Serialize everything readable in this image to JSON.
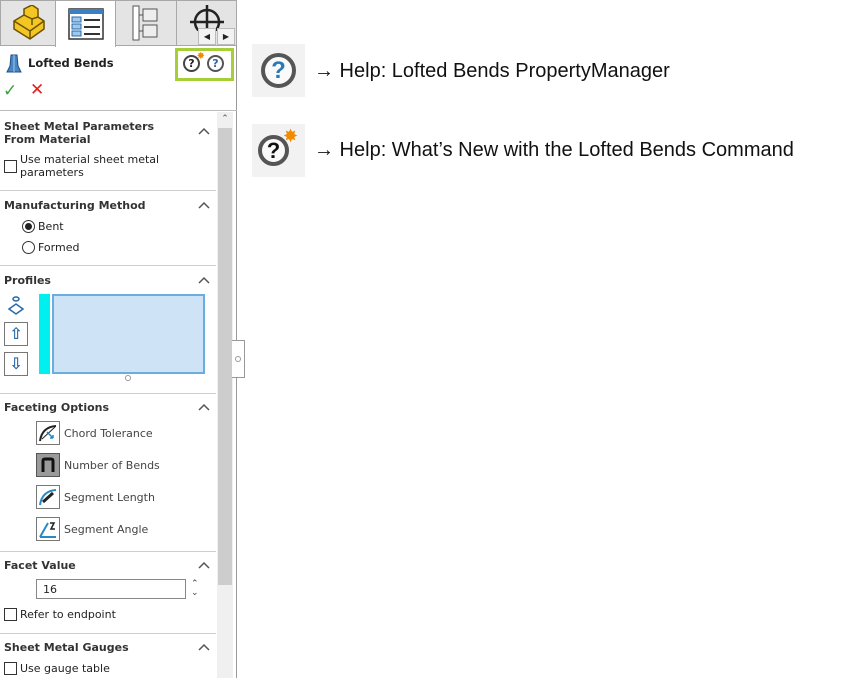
{
  "panel": {
    "tabs": [
      {
        "name": "feature-manager",
        "icon": "part-icon"
      },
      {
        "name": "property-manager",
        "icon": "property-list-icon",
        "active": true
      },
      {
        "name": "configuration-manager",
        "icon": "configuration-tree-icon"
      },
      {
        "name": "dimxpert-manager",
        "icon": "crosshair-icon"
      }
    ],
    "title": "Lofted Bends",
    "sections": {
      "material": {
        "title": "Sheet Metal Parameters From Material",
        "checkbox_label": "Use material sheet metal parameters",
        "checked": false
      },
      "method": {
        "title": "Manufacturing Method",
        "options": [
          "Bent",
          "Formed"
        ],
        "selected": "Bent"
      },
      "profiles": {
        "title": "Profiles",
        "list_color": "#cfe3f7",
        "marker_color": "#00f0f0"
      },
      "faceting": {
        "title": "Faceting Options",
        "options": [
          "Chord Tolerance",
          "Number of Bends",
          "Segment Length",
          "Segment Angle"
        ],
        "selected": "Number of Bends"
      },
      "facet": {
        "title": "Facet Value",
        "value": "16",
        "checkbox_label": "Refer to endpoint",
        "checked": false
      },
      "gauges": {
        "title": "Sheet Metal Gauges",
        "checkbox_label": "Use gauge table",
        "checked": false
      }
    },
    "highlight_color": "#a6ce39"
  },
  "legend": [
    {
      "icon": "help-icon",
      "text": "→ Help: Lofted Bends PropertyManager"
    },
    {
      "icon": "whats-new-help-icon",
      "text": "→ Help: What’s New with the Lofted Bends Command"
    }
  ]
}
